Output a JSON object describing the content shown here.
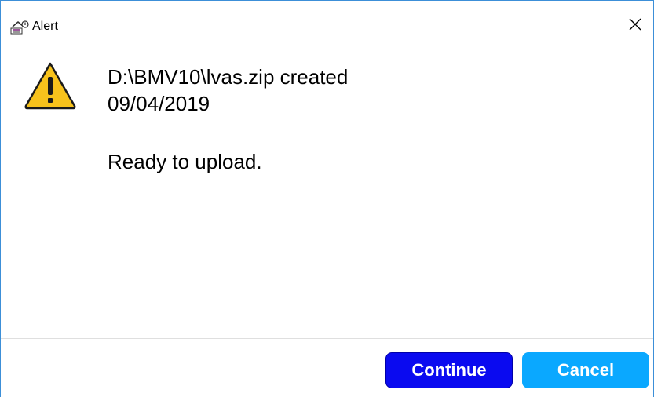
{
  "window": {
    "title": "Alert",
    "app_icon": "alert-app-icon",
    "close_icon": "close-icon"
  },
  "message": {
    "icon": "warning-icon",
    "line1": "D:\\BMV10\\lvas.zip created",
    "line2": "09/04/2019",
    "line3": "Ready to upload."
  },
  "buttons": {
    "continue_label": "Continue",
    "cancel_label": "Cancel"
  },
  "colors": {
    "continue_bg": "#0a0af0",
    "cancel_bg": "#0aa8ff",
    "window_border": "#3c8fd8",
    "warning_fill": "#f7c21c"
  }
}
